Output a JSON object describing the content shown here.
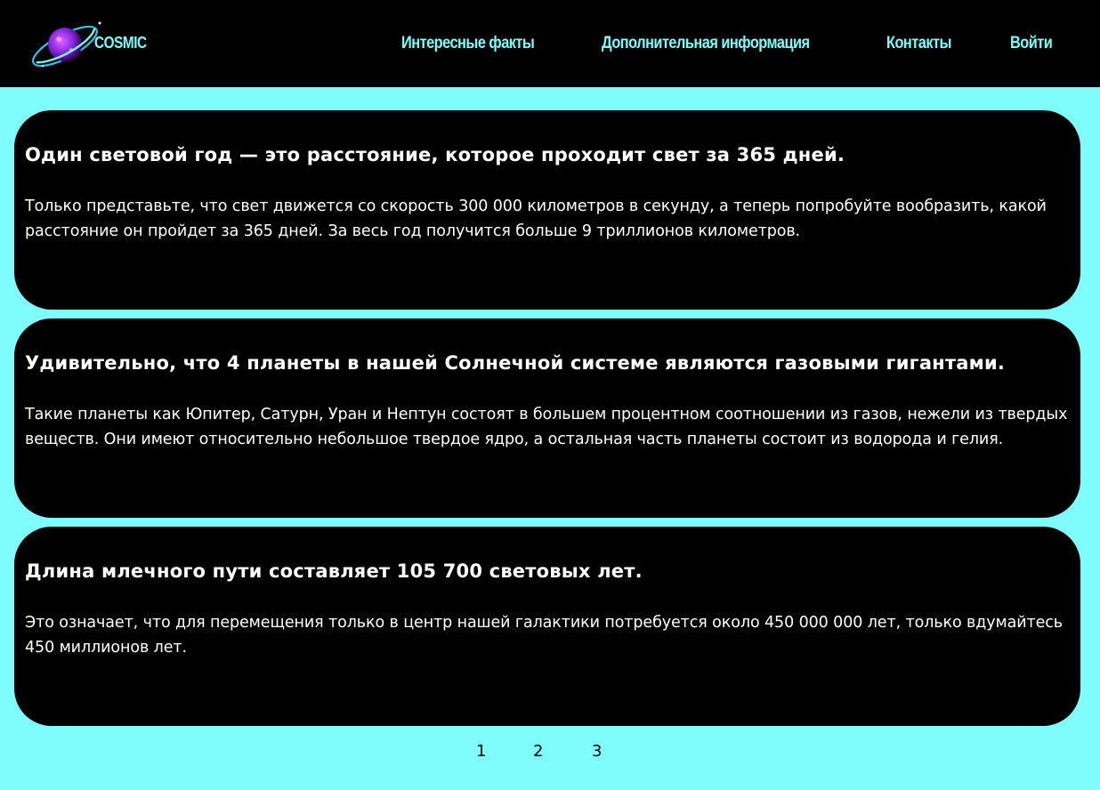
{
  "header": {
    "brand": "COSMIC",
    "nav": [
      {
        "label": "Интересные факты"
      },
      {
        "label": "Дополнительная информация"
      },
      {
        "label": "Контакты"
      },
      {
        "label": "Войти"
      }
    ]
  },
  "colors": {
    "background": "#7ffcfc",
    "accent": "#7ffcfc",
    "card": "#000000",
    "text": "#ffffff"
  },
  "facts": [
    {
      "title": "Один световой год — это расстояние, которое проходит свет за 365 дней.",
      "text": "Только представьте, что свет движется со скорость 300 000 километров в секунду, а теперь попробуйте вообразить, какой расстояние он пройдет за 365 дней. За весь год получится больше 9 триллионов километров."
    },
    {
      "title": "Удивительно, что 4 планеты в нашей Солнечной системе являются газовыми гигантами.",
      "text": "Такие планеты как Юпитер, Сатурн, Уран и Нептун состоят в большем процентном соотношении из газов, нежели из твердых веществ. Они имеют относительно небольшое твердое ядро, а остальная часть планеты состоит из водорода и гелия."
    },
    {
      "title": "Длина млечного пути составляет 105 700 световых лет.",
      "text": "Это означает, что для перемещения только в центр нашей галактики потребуется около 450 000 000 лет, только вдумайтесь 450 миллионов лет."
    }
  ],
  "pagination": [
    "1",
    "2",
    "3"
  ]
}
